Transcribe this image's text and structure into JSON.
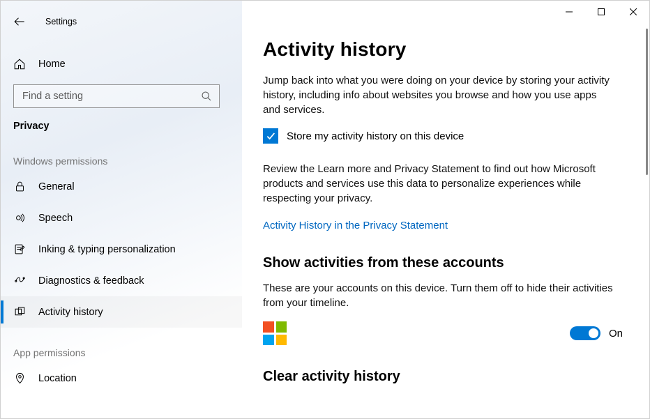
{
  "window": {
    "title": "Settings"
  },
  "sidebar": {
    "home": "Home",
    "search_placeholder": "Find a setting",
    "current_section": "Privacy",
    "groups": [
      {
        "label": "Windows permissions",
        "items": [
          {
            "icon": "lock-icon",
            "label": "General"
          },
          {
            "icon": "speech-icon",
            "label": "Speech"
          },
          {
            "icon": "inking-icon",
            "label": "Inking & typing personalization"
          },
          {
            "icon": "diagnostics-icon",
            "label": "Diagnostics & feedback"
          },
          {
            "icon": "activity-icon",
            "label": "Activity history",
            "selected": true
          }
        ]
      },
      {
        "label": "App permissions",
        "items": [
          {
            "icon": "location-icon",
            "label": "Location"
          }
        ]
      }
    ]
  },
  "main": {
    "title": "Activity history",
    "intro": "Jump back into what you were doing on your device by storing your activity history, including info about websites you browse and how you use apps and services.",
    "checkbox": {
      "checked": true,
      "label": "Store my activity history on this device"
    },
    "review": "Review the Learn more and Privacy Statement to find out how Microsoft products and services use this data to personalize experiences while respecting your privacy.",
    "link": "Activity History in the Privacy Statement",
    "accounts": {
      "heading": "Show activities from these accounts",
      "desc": "These are your accounts on this device. Turn them off to hide their activities from your timeline.",
      "toggle_state": "On"
    },
    "clear_heading": "Clear activity history"
  }
}
